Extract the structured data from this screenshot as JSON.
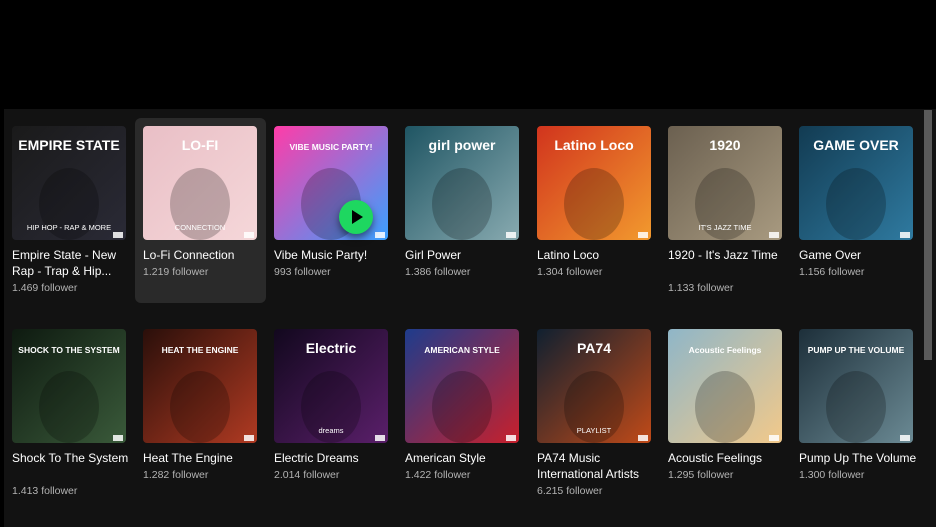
{
  "playlists": [
    {
      "title": "Empire State - New Rap - Trap & Hip...",
      "followers": "1.469 follower",
      "cover_text": "EMPIRE STATE",
      "cover_sub": "HIP HOP - RAP & MORE",
      "colors": [
        "#1a1a1a",
        "#2a2a36"
      ]
    },
    {
      "title": "Lo-Fi Connection",
      "followers": "1.219 follower",
      "cover_text": "LO-FI",
      "cover_sub": "CONNECTION",
      "colors": [
        "#e9bfc6",
        "#f5d7d9"
      ]
    },
    {
      "title": "Vibe Music Party!",
      "followers": "993 follower",
      "cover_text": "VIBE MUSIC PARTY!",
      "cover_sub": "",
      "colors": [
        "#ff3ca8",
        "#3aa0ff"
      ]
    },
    {
      "title": "Girl Power",
      "followers": "1.386 follower",
      "cover_text": "girl power",
      "cover_sub": "",
      "colors": [
        "#1f5563",
        "#88aab0"
      ]
    },
    {
      "title": "Latino Loco",
      "followers": "1.304 follower",
      "cover_text": "Latino Loco",
      "cover_sub": "",
      "colors": [
        "#d1341d",
        "#f29a2e"
      ]
    },
    {
      "title": "1920 - It's Jazz Time",
      "followers": "1.133 follower",
      "cover_text": "1920",
      "cover_sub": "IT'S JAZZ TIME",
      "colors": [
        "#6b6050",
        "#a89a80"
      ]
    },
    {
      "title": "Game Over",
      "followers": "1.156 follower",
      "cover_text": "GAME OVER",
      "cover_sub": "",
      "colors": [
        "#123b52",
        "#2f7aa0"
      ]
    },
    {
      "title": "Shock To The System",
      "followers": "1.413 follower",
      "cover_text": "SHOCK TO THE SYSTEM",
      "cover_sub": "",
      "colors": [
        "#0e1a10",
        "#3a5a3a"
      ]
    },
    {
      "title": "Heat The Engine",
      "followers": "1.282 follower",
      "cover_text": "HEAT THE ENGINE",
      "cover_sub": "",
      "colors": [
        "#2a0f0a",
        "#b03a22"
      ]
    },
    {
      "title": "Electric Dreams",
      "followers": "2.014 follower",
      "cover_text": "Electric",
      "cover_sub": "dreams",
      "colors": [
        "#12081e",
        "#5a1f6a"
      ]
    },
    {
      "title": "American Style",
      "followers": "1.422 follower",
      "cover_text": "AMERICAN STYLE",
      "cover_sub": "",
      "colors": [
        "#1e3c8c",
        "#c8202c"
      ]
    },
    {
      "title": "PA74 Music International Artists",
      "followers": "6.215 follower",
      "cover_text": "PA74",
      "cover_sub": "PLAYLIST",
      "colors": [
        "#102030",
        "#c04a18"
      ]
    },
    {
      "title": "Acoustic Feelings",
      "followers": "1.295 follower",
      "cover_text": "Acoustic Feelings",
      "cover_sub": "",
      "colors": [
        "#8fb6c8",
        "#f2c98a"
      ]
    },
    {
      "title": "Pump Up The Volume",
      "followers": "1.300 follower",
      "cover_text": "PUMP UP THE VOLUME",
      "cover_sub": "",
      "colors": [
        "#1d2f3a",
        "#6b8a94"
      ]
    }
  ],
  "hovered_card": "Lo-Fi Connection",
  "play_button_card": "Vibe Music Party!",
  "accent": "#1ed760"
}
